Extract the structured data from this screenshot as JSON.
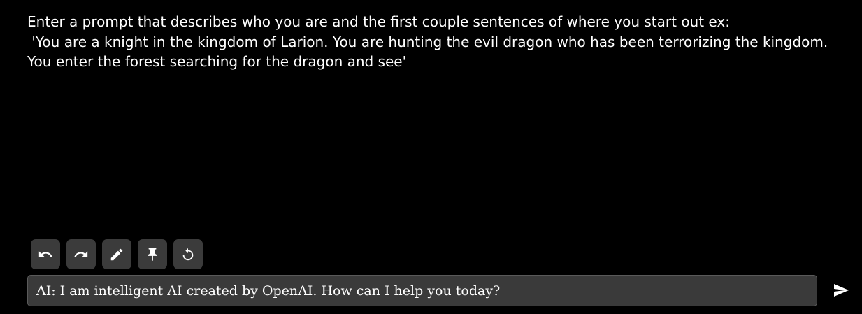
{
  "story": {
    "text": "Enter a prompt that describes who you are and the first couple sentences of where you start out ex:\n 'You are a knight in the kingdom of Larion. You are hunting the evil dragon who has been terrorizing the kingdom. You enter the forest searching for the dragon and see'"
  },
  "toolbar": {
    "buttons": [
      {
        "icon": "undo-icon"
      },
      {
        "icon": "redo-icon"
      },
      {
        "icon": "edit-icon"
      },
      {
        "icon": "pin-icon"
      },
      {
        "icon": "refresh-icon"
      }
    ]
  },
  "input": {
    "value": "AI: I am intelligent AI created by OpenAI. How can I help you today?"
  },
  "send": {
    "icon": "send-icon"
  },
  "colors": {
    "background": "#000000",
    "button_bg": "#3b3b3b",
    "input_bg": "#3a3a3a",
    "text": "#ffffff"
  }
}
